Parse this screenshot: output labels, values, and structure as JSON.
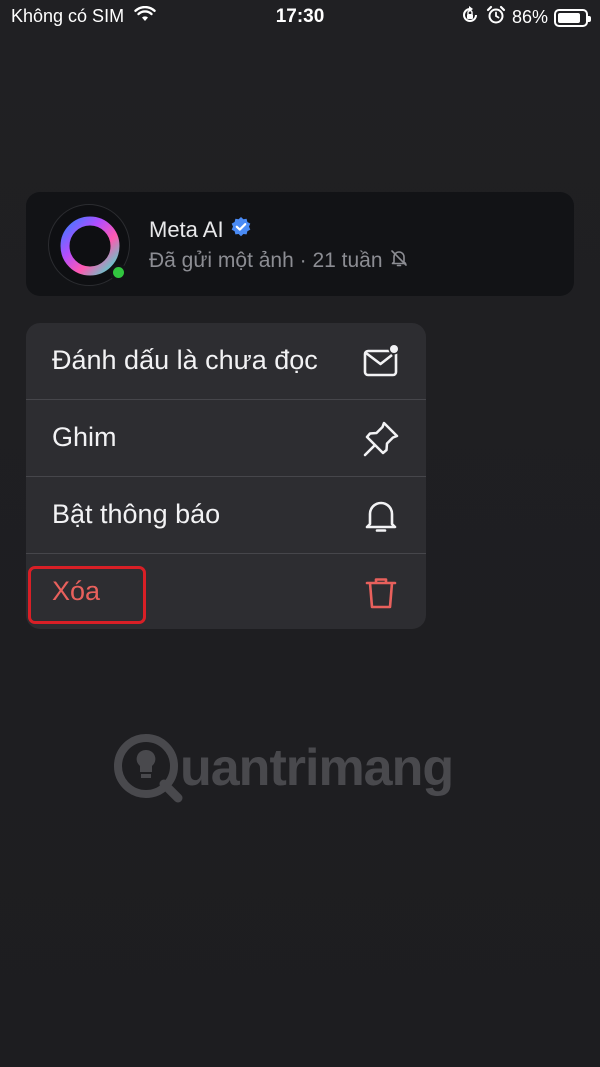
{
  "status_bar": {
    "carrier": "Không có SIM",
    "time": "17:30",
    "battery_percent": "86%",
    "battery_level": 0.86,
    "icons": [
      "wifi-icon",
      "rotation-lock-icon",
      "alarm-icon",
      "battery-icon"
    ]
  },
  "chat": {
    "name": "Meta AI",
    "verified_icon": "verified-badge-icon",
    "subtitle": "Đã gửi một ảnh · 21 tuần",
    "muted_icon": "bell-slash-icon",
    "online": true,
    "online_color": "#31c63f"
  },
  "menu": {
    "items": [
      {
        "label": "Đánh dấu là chưa đọc",
        "icon": "mail-unread-icon"
      },
      {
        "label": "Ghim",
        "icon": "pin-icon"
      },
      {
        "label": "Bật thông báo",
        "icon": "bell-icon"
      },
      {
        "label": "Xóa",
        "icon": "trash-icon",
        "color": "#e8605c"
      }
    ]
  },
  "watermark": {
    "text": "uantrimang",
    "logo_icon": "quantrimang-logo-icon"
  }
}
